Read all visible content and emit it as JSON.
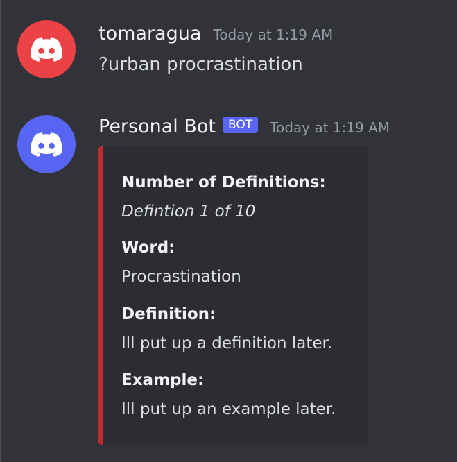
{
  "messages": [
    {
      "username": "tomaragua",
      "timestamp": "Today at 1:19 AM",
      "content": "?urban procrastination",
      "avatar_color": "#ed4245",
      "avatar_icon": "discord-logo-icon"
    },
    {
      "username": "Personal Bot",
      "badge": "BOT",
      "timestamp": "Today at 1:19 AM",
      "avatar_color": "#5865f2",
      "avatar_icon": "discord-logo-icon",
      "embed": {
        "accent_color": "#b92d2f",
        "fields": [
          {
            "name": "Number of Definitions:",
            "value": "Defintion 1 of 10"
          },
          {
            "name": "Word:",
            "value": "Procrastination"
          },
          {
            "name": "Definition:",
            "value": "Ill put up a definition later."
          },
          {
            "name": "Example:",
            "value": "Ill put up an example later."
          }
        ]
      }
    }
  ]
}
